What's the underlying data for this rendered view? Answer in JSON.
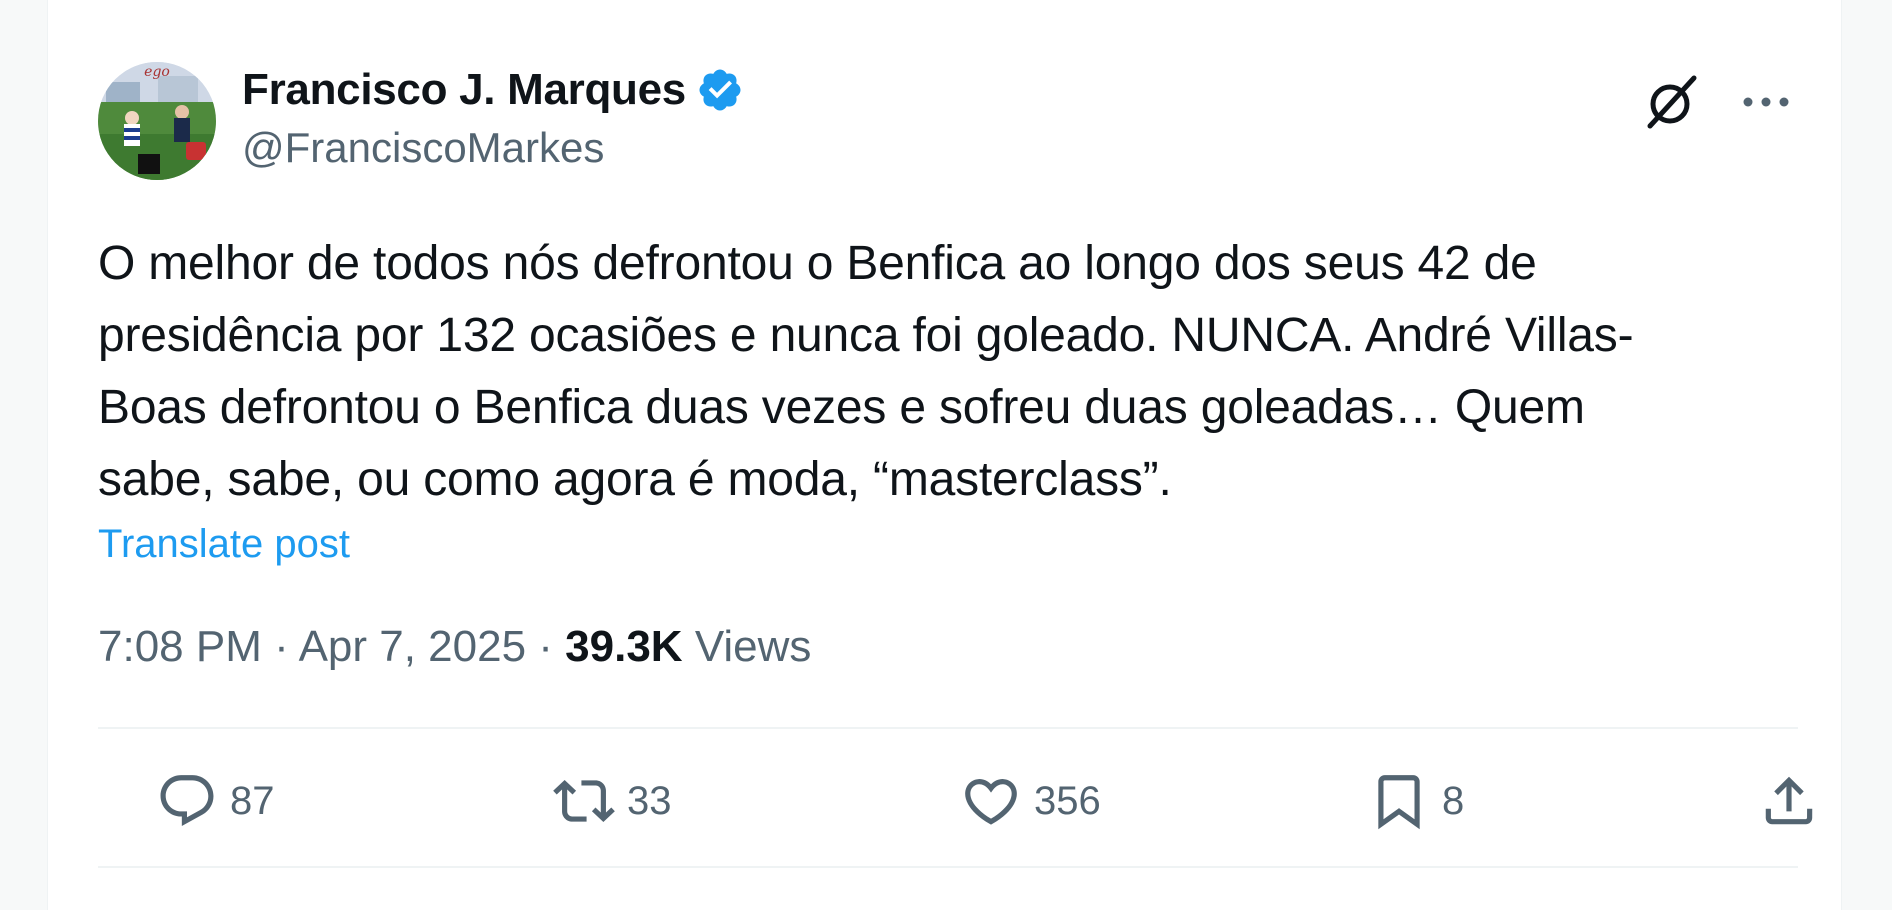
{
  "author": {
    "display_name": "Francisco J. Marques",
    "handle": "@FranciscoMarkes",
    "verified": true,
    "avatar_icon": "avatar-image"
  },
  "tweet": {
    "text": "O melhor de todos nós defrontou o Benfica ao longo dos seus 42 de\npresidência por 132 ocasiões e nunca foi goleado. NUNCA. André Villas-\nBoas defrontou o Benfica duas vezes e sofreu duas goleadas… Quem\nsabe, sabe, ou como agora é moda, “masterclass”.",
    "translate_label": "Translate post",
    "time": "7:08 PM",
    "separator": " · ",
    "date": "Apr 7, 2025",
    "views_count": "39.3K",
    "views_label": "Views"
  },
  "header_icons": {
    "grok": "grok-icon",
    "more": "more-icon"
  },
  "actions": {
    "replies": "87",
    "retweets": "33",
    "likes": "356",
    "bookmarks": "8"
  },
  "colors": {
    "accent": "#1d9bf0",
    "text_primary": "#0f1419",
    "text_secondary": "#536471",
    "divider": "#eff3f4"
  }
}
